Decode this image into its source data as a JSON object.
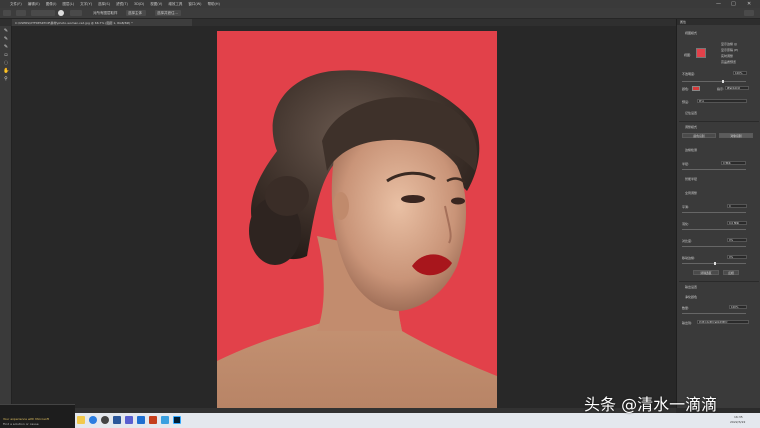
{
  "menubar": {
    "items": [
      "文件(F)",
      "编辑(E)",
      "图像(I)",
      "图层(L)",
      "文字(Y)",
      "选择(S)",
      "滤镜(T)",
      "3D(D)",
      "视图(V)",
      "增效工具",
      "窗口(W)",
      "帮助(H)"
    ],
    "minimize": "—",
    "maximize": "□",
    "close": "✕"
  },
  "options": {
    "sample_all_layers": "对所有图层取样",
    "select_subject": "选择主体",
    "select_and_mask": "选择并遮住..."
  },
  "tab": {
    "title": "C:\\USERS\\XTFDESKTOP\\素材\\photo-woman-red.jpg @ 66.7% (图层 1, RGB/8#) *",
    "close": "✕"
  },
  "panel": {
    "header": "属性",
    "section_view": "视图模式",
    "view_label": "视图:",
    "show_edge": "显示边缘 (J)",
    "show_original": "显示原稿 (P)",
    "realtime_refine": "实时调整",
    "high_quality_preview": "高品质预览",
    "opacity_label": "不透明度:",
    "opacity_value": "100%",
    "color_label": "颜色:",
    "indicates_label": "指示:",
    "indicates_value": "被蒙版区域",
    "preset_label": "预设:",
    "preset_value": "默认",
    "save_settings": "记住设置",
    "refine_mode_header": "调整模式",
    "mode_color_aware": "颜色识别",
    "mode_object_aware": "对象识别",
    "edge_detection_header": "边缘检测",
    "radius_label": "半径:",
    "radius_value": "0 像素",
    "smart_radius": "智能半径",
    "global_refine_header": "全局调整",
    "smooth_label": "平滑:",
    "smooth_value": "0",
    "feather_label": "羽化:",
    "feather_value": "0.0 像素",
    "contrast_label": "对比度:",
    "contrast_value": "0%",
    "shift_edge_label": "移动边缘:",
    "shift_edge_value": "0%",
    "clear_selection": "清除选区",
    "invert": "反相",
    "output_header": "输出设置",
    "decontaminate": "净化颜色",
    "amount_label": "数量:",
    "amount_value": "100%",
    "output_to_label": "输出到:",
    "output_to_value": "新建带有图层蒙版的图层"
  },
  "taskbar": {
    "notification_line1": "Your experience with Microsoft",
    "notification_line2": "Find a solution or cause",
    "time": "16:35",
    "date": "2022/3/22"
  },
  "watermark": "头条 @清水一滴滴",
  "colors": {
    "canvas_bg": "#e2414a",
    "mask_color": "#d63a3a",
    "accent": "#2a7de1"
  }
}
